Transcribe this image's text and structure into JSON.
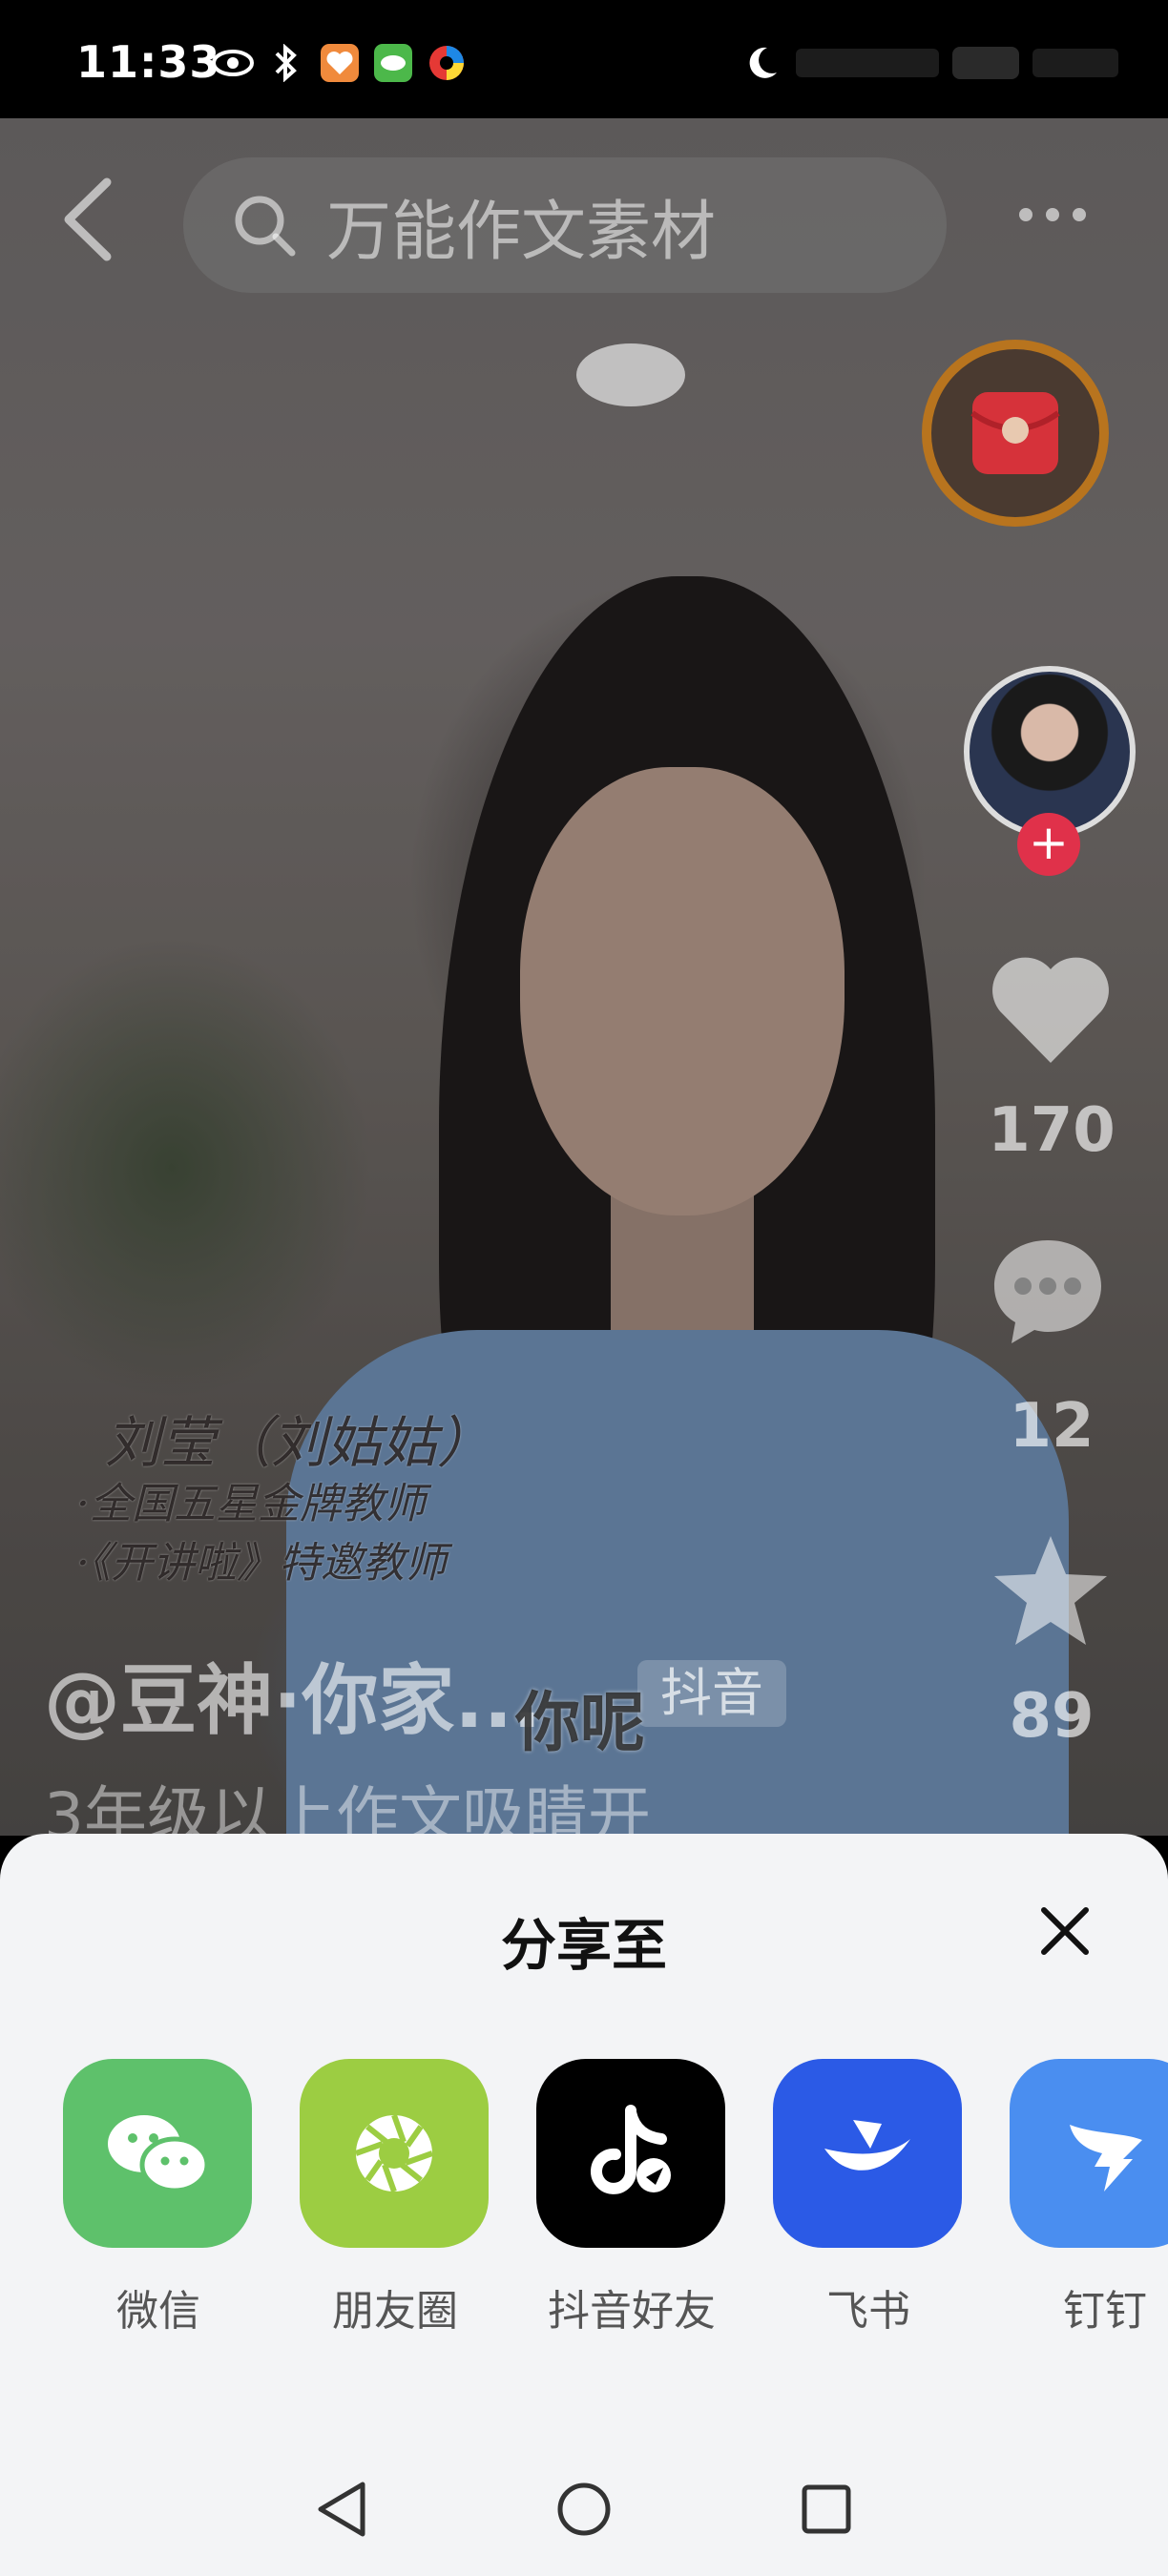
{
  "status_bar": {
    "time": "11:33"
  },
  "search": {
    "placeholder": "万能作文素材"
  },
  "video": {
    "overlay_name": "刘莹（刘姑姑）",
    "overlay_lines": [
      "·全国五星金牌教师",
      "·《开讲啦》特邀教师"
    ],
    "author": "@豆神·你家...",
    "watermark": "抖音",
    "subtitle": "你呢",
    "description": "3年级以上作文吸睛开"
  },
  "actions": {
    "likes": "170",
    "comments": "12",
    "favorites": "89"
  },
  "share_sheet": {
    "title": "分享至",
    "targets": [
      {
        "label": "微信",
        "icon": "wechat-icon",
        "color": "#5ec16b"
      },
      {
        "label": "朋友圈",
        "icon": "moments-icon",
        "color": "#9ccd42"
      },
      {
        "label": "抖音好友",
        "icon": "douyin-icon",
        "color": "#000000"
      },
      {
        "label": "飞书",
        "icon": "feishu-icon",
        "color": "#2b5ae6"
      },
      {
        "label": "钉钉",
        "icon": "dingtalk-icon",
        "color": "#4a8ef0"
      }
    ]
  },
  "colors": {
    "sheet_bg": "#f3f4f6",
    "follow_red": "#e0314a"
  }
}
